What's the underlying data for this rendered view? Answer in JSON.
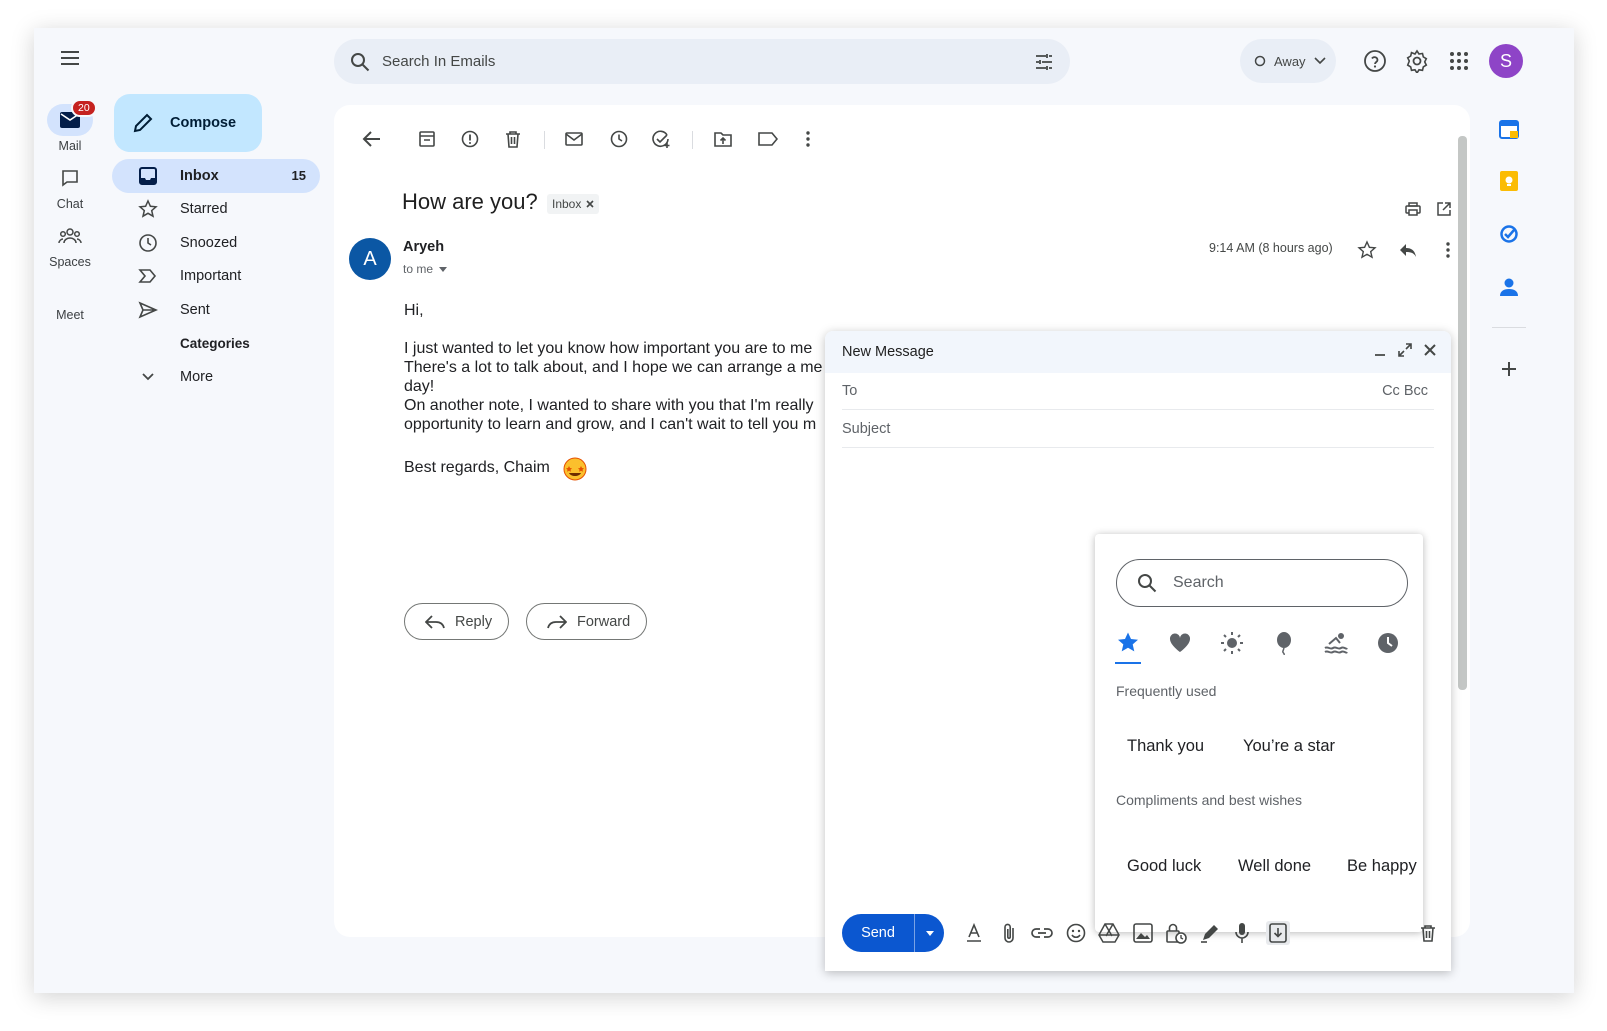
{
  "rail": {
    "mail_label": "Mail",
    "mail_badge": "20",
    "chat_label": "Chat",
    "spaces_label": "Spaces",
    "meet_label": "Meet"
  },
  "compose_button": "Compose",
  "nav": {
    "inbox": "Inbox",
    "inbox_count": "15",
    "starred": "Starred",
    "snoozed": "Snoozed",
    "important": "Important",
    "sent": "Sent",
    "categories": "Categories",
    "more": "More"
  },
  "search": {
    "placeholder": "Search In Emails"
  },
  "status": {
    "label": "Away"
  },
  "account": {
    "initial": "S"
  },
  "email": {
    "subject": "How are you?",
    "label_chip": "Inbox",
    "sender_initial": "A",
    "sender": "Aryeh",
    "to": "to me",
    "time": "9:14 AM (8 hours ago)",
    "body": "Hi,\n\nI just wanted to let you know how important you are to me\nThere's a lot to talk about, and I hope we can arrange a me\nday!\nOn another note, I wanted to share with you that I'm really\nopportunity to learn and grow, and I can't wait to tell you m",
    "signature": "Best regards, Chaim",
    "reply_label": "Reply",
    "forward_label": "Forward"
  },
  "new_message": {
    "title": "New Message",
    "to_label": "To",
    "cc_bcc": "Cc Bcc",
    "subject_placeholder": "Subject",
    "send_label": "Send"
  },
  "stickers": {
    "search_placeholder": "Search",
    "section_frequent": "Frequently used",
    "frequent": [
      "Thank you",
      "You’re a star"
    ],
    "section_compliments": "Compliments and best wishes",
    "compliments": [
      "Good luck",
      "Well done",
      "Be happy"
    ]
  },
  "colors": {
    "accent": "#0b57d0",
    "active_nav": "#d3e3fd",
    "compose": "#c2e7ff",
    "badge": "#c5221f",
    "avatar": "#8e44c7",
    "sender_avatar": "#0b57a4"
  }
}
